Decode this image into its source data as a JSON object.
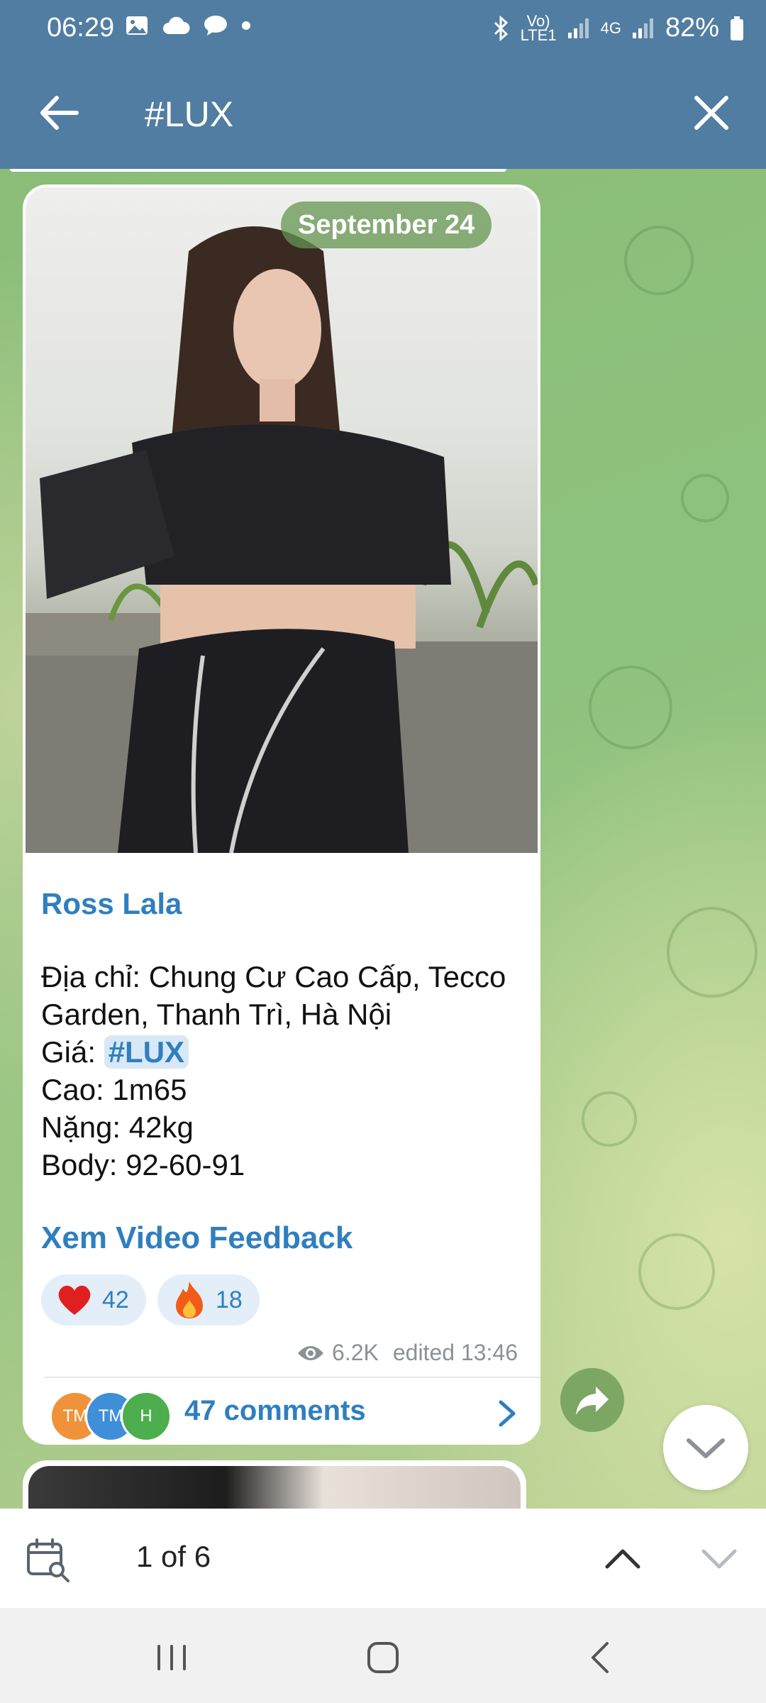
{
  "status_bar": {
    "time": "06:29",
    "signal_1": "Vo)\nLTE1",
    "signal_2": "4G",
    "battery": "82%"
  },
  "app_bar": {
    "title": "#LUX"
  },
  "message": {
    "date_chip": "September 24",
    "sender": "Ross Lala",
    "lines": {
      "l1": "Địa chỉ: Chung Cư Cao Cấp, Tecco",
      "l2": "Garden, Thanh Trì, Hà Nội",
      "l3_prefix": "Giá: ",
      "l3_tag": "#LUX",
      "l4": "Cao: 1m65",
      "l5": "Nặng: 42kg",
      "l6": "Body: 92-60-91"
    },
    "link": "Xem Video Feedback",
    "reactions": [
      {
        "emoji": "heart",
        "count": "42"
      },
      {
        "emoji": "fire",
        "count": "18"
      }
    ],
    "views": "6.2K",
    "edited": "edited 13:46",
    "comments": {
      "avatars": [
        "TM",
        "TM",
        "H"
      ],
      "avatar_colors": [
        "#f0923a",
        "#3f8fd8",
        "#4cae4c"
      ],
      "label": "47 comments"
    }
  },
  "search_nav": {
    "result_count": "1 of 6"
  },
  "colors": {
    "header": "#517da2",
    "accent": "#2f7fbf"
  }
}
